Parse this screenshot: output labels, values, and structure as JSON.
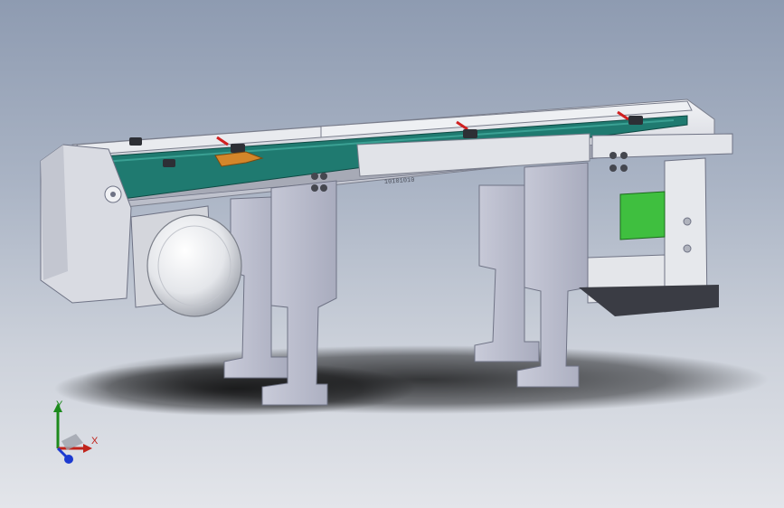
{
  "viewport": {
    "background_top": "#8e9bb1",
    "background_bottom": "#e3e5ea"
  },
  "model": {
    "belt_color": "#1f7a70",
    "frame_color": "#d6d9e2",
    "leg_color": "#b9bccc",
    "motor_color": "#eceef1",
    "sensor_color": "#3fbf3f",
    "clamp_color": "#d4862a",
    "marker_color": "#d02020",
    "rail_label": "10101010"
  },
  "triad": {
    "y_label": "Y",
    "x_label": "X",
    "y_color": "#1c8a1c",
    "x_color": "#c0241c",
    "z_color": "#1c3ad0"
  }
}
